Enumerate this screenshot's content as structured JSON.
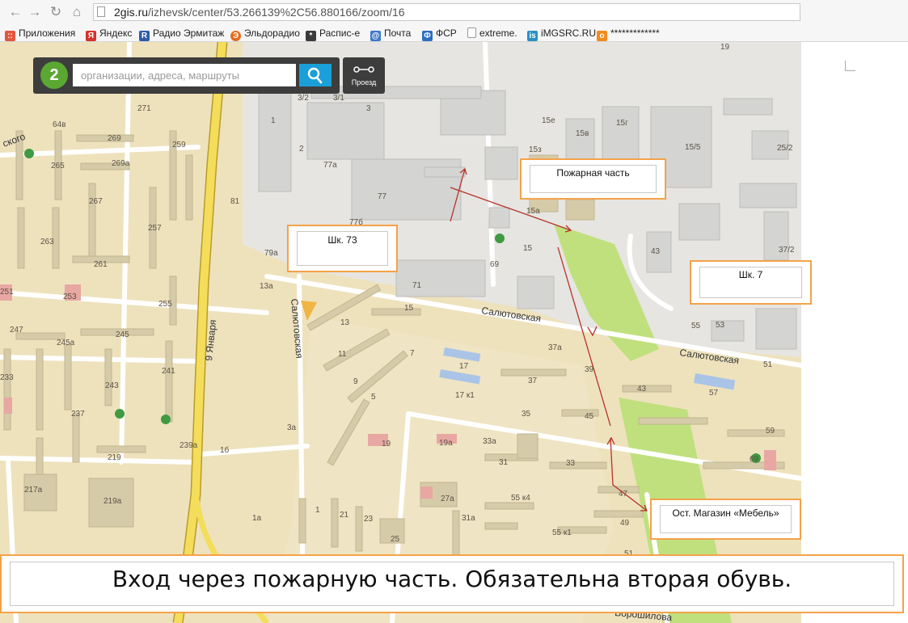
{
  "browser": {
    "url_host": "2gis.ru",
    "url_path": "/izhevsk/center/53.266139%2C56.880166/zoom/16",
    "bookmarks": [
      {
        "label": "Приложения",
        "icon": "apps-grid-icon",
        "color": "#e4573d"
      },
      {
        "label": "Яндекс",
        "icon": "yandex-icon",
        "color": "#d8322a"
      },
      {
        "label": "Радио Эрмитаж",
        "icon": "radio-hermitage-icon",
        "color": "#2f5ca8"
      },
      {
        "label": "Эльдорадио",
        "icon": "eldoradio-icon",
        "color": "#e86a1c"
      },
      {
        "label": "Распис-е",
        "icon": "schedule-icon",
        "color": "#3b3b3b"
      },
      {
        "label": "Почта",
        "icon": "mail-icon",
        "color": "#3b79c9"
      },
      {
        "label": "ФСР",
        "icon": "fsr-icon",
        "color": "#2d6fc0"
      },
      {
        "label": "extreme.",
        "icon": "page-icon",
        "color": "#888888"
      },
      {
        "label": "iMGSRC.RU",
        "icon": "imgsrc-icon",
        "color": "#2a8fc4"
      },
      {
        "label": "*************",
        "icon": "odnoklassniki-icon",
        "color": "#f28b1e"
      }
    ]
  },
  "search": {
    "placeholder": "организации, адреса, маршруты",
    "route_label": "Проезд"
  },
  "map": {
    "streets": [
      "Салютовская",
      "Салютовская",
      "Салютовская",
      "9 Января",
      "Салютовская",
      "Ворошилова"
    ],
    "house_numbers": [
      "271",
      "64в",
      "269",
      "269а",
      "265",
      "267",
      "263",
      "261",
      "259",
      "257",
      "253",
      "255",
      "251",
      "247",
      "245",
      "245а",
      "243",
      "241",
      "237",
      "233",
      "219",
      "217а",
      "219а",
      "239а",
      "1б",
      "81",
      "79а",
      "13а",
      "77а",
      "77",
      "77б",
      "71",
      "69",
      "15",
      "3/2",
      "3/1",
      "3",
      "1",
      "2",
      "15е",
      "15в",
      "15г",
      "15/5",
      "25/2",
      "15з",
      "15а",
      "43",
      "37/2",
      "55",
      "53",
      "51",
      "37а",
      "37",
      "39",
      "43",
      "57",
      "59",
      "69",
      "17",
      "17 к1",
      "13",
      "11",
      "9",
      "7",
      "5",
      "3а",
      "35",
      "45",
      "19",
      "19а",
      "33а",
      "31",
      "33",
      "27а",
      "31а",
      "55 к4",
      "55 к1",
      "47",
      "49",
      "25",
      "21",
      "23",
      "1а",
      "1",
      "51",
      "19"
    ],
    "colors": {
      "ground": "#eee2bd",
      "industrial": "#e4e4e2",
      "building": "#d1c6a6",
      "park": "#c0e07e",
      "road_main": "#f3dd5a"
    }
  },
  "annotations": {
    "fire_station": "Пожарная часть",
    "school_73": "Шк. 73",
    "school_7": "Шк. 7",
    "bus_stop": "Ост. Магазин «Мебель»",
    "caption": "Вход через пожарную часть. Обязательна вторая обувь.",
    "accent_color": "#f4a24a",
    "route_color": "#b5322a"
  }
}
